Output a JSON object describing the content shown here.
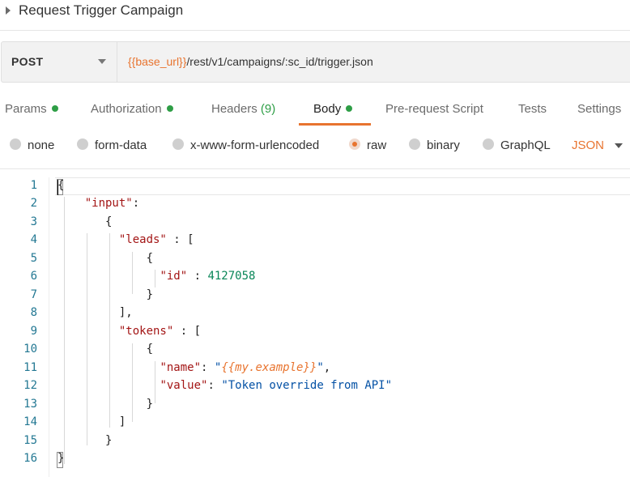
{
  "request": {
    "title": "Request Trigger Campaign",
    "method": "POST",
    "url_var": "{{base_url}}",
    "url_path": "/rest/v1/campaigns/:sc_id/trigger.json"
  },
  "tabs": [
    {
      "label": "Params",
      "dot": true
    },
    {
      "label": "Authorization",
      "dot": true
    },
    {
      "label": "Headers",
      "count": "(9)"
    },
    {
      "label": "Body",
      "dot": true,
      "active": true
    },
    {
      "label": "Pre-request Script"
    },
    {
      "label": "Tests"
    },
    {
      "label": "Settings"
    }
  ],
  "body_types": {
    "options": [
      "none",
      "form-data",
      "x-www-form-urlencoded",
      "raw",
      "binary",
      "GraphQL"
    ],
    "selected": "raw",
    "language": "JSON"
  },
  "editor": {
    "line_numbers": [
      "1",
      "2",
      "3",
      "4",
      "5",
      "6",
      "7",
      "8",
      "9",
      "10",
      "11",
      "12",
      "13",
      "14",
      "15",
      "16"
    ],
    "code": {
      "l1": "{",
      "l2_key": "\"input\"",
      "l2_rest": ":",
      "l3": "{",
      "l4_key": "\"leads\"",
      "l4_rest": " : [",
      "l5": "{",
      "l6_key": "\"id\"",
      "l6_mid": " : ",
      "l6_val": "4127058",
      "l7": "}",
      "l8": "],",
      "l9_key": "\"tokens\"",
      "l9_rest": " : [",
      "l10": "{",
      "l11_key": "\"name\"",
      "l11_mid": ": ",
      "l11_q1": "\"",
      "l11_var": "{{my.example}}",
      "l11_q2": "\"",
      "l11_end": ",",
      "l12_key": "\"value\"",
      "l12_mid": ": ",
      "l12_val": "\"Token override from API\"",
      "l13": "}",
      "l14": "]",
      "l15": "}",
      "l16": "}"
    }
  },
  "colors": {
    "accent": "#e8742f",
    "status_dot": "#2e9e46",
    "json_key": "#a31515",
    "json_number": "#098658",
    "json_string": "#0451a5",
    "line_number": "#237893"
  }
}
